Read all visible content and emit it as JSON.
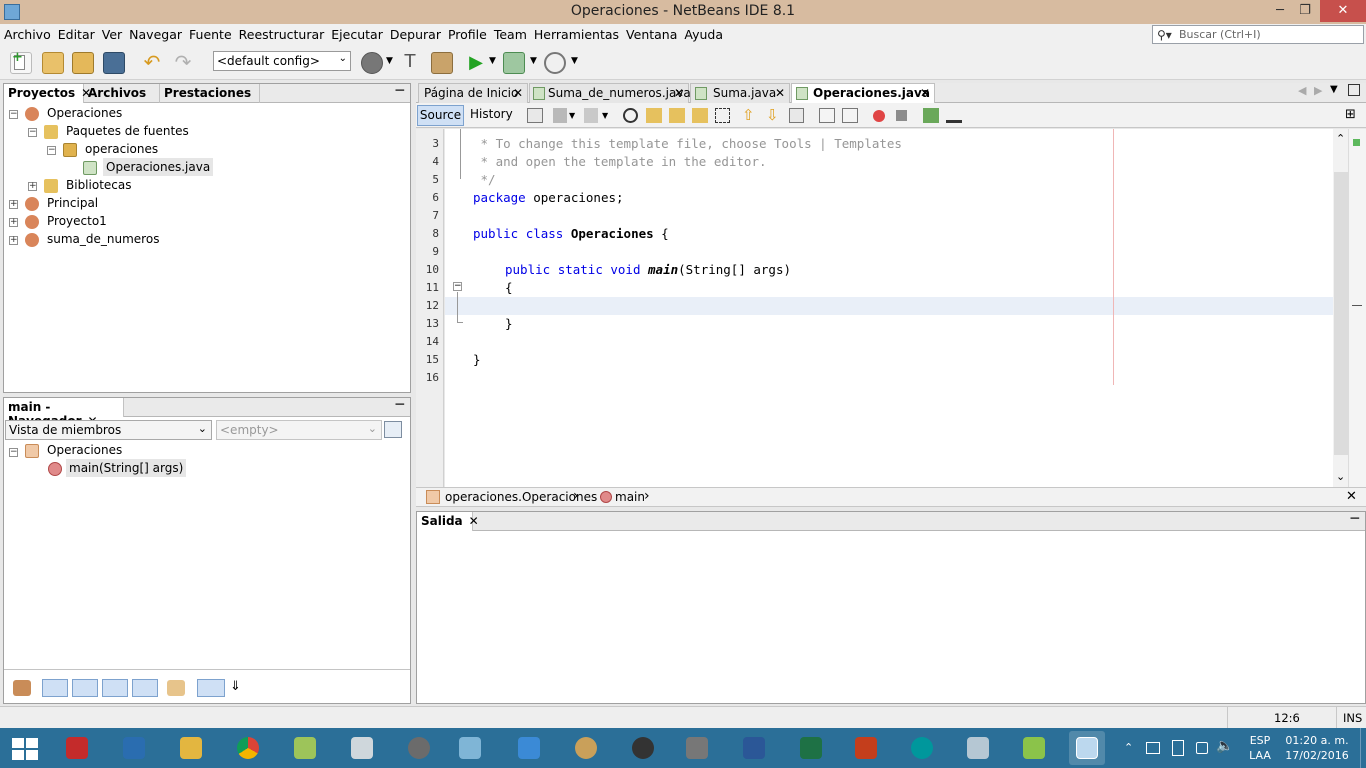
{
  "window": {
    "title": "Operaciones - NetBeans IDE 8.1",
    "controls": {
      "minimize": "─",
      "maximize": "❐",
      "close": "✕"
    }
  },
  "menu": [
    "Archivo",
    "Editar",
    "Ver",
    "Navegar",
    "Fuente",
    "Reestructurar",
    "Ejecutar",
    "Depurar",
    "Profile",
    "Team",
    "Herramientas",
    "Ventana",
    "Ayuda"
  ],
  "search": {
    "placeholder": "Buscar (Ctrl+I)"
  },
  "toolbar": {
    "config": "<default config>"
  },
  "projects_panel": {
    "tabs": [
      "Proyectos",
      "Archivos",
      "Prestaciones"
    ],
    "tree": [
      {
        "label": "Operaciones",
        "expanded": true
      },
      {
        "label": "Paquetes de fuentes",
        "expanded": true
      },
      {
        "label": "operaciones",
        "expanded": true
      },
      {
        "label": "Operaciones.java",
        "selected": true
      },
      {
        "label": "Bibliotecas",
        "expanded": false
      },
      {
        "label": "Principal",
        "expanded": false
      },
      {
        "label": "Proyecto1",
        "expanded": false
      },
      {
        "label": "suma_de_numeros",
        "expanded": false
      }
    ]
  },
  "navigator_panel": {
    "title": "main - Navegador",
    "view_select": "Vista de miembros",
    "filter_select": "<empty>",
    "tree": [
      {
        "label": "Operaciones"
      },
      {
        "label": "main(String[] args)"
      }
    ]
  },
  "editor": {
    "tabs": [
      {
        "label": "Página de Inicio",
        "active": false
      },
      {
        "label": "Suma_de_numeros.java",
        "active": false
      },
      {
        "label": "Suma.java",
        "active": false
      },
      {
        "label": "Operaciones.java",
        "active": true
      }
    ],
    "view_buttons": {
      "source": "Source",
      "history": "History"
    },
    "line_numbers": [
      "3",
      "4",
      "5",
      "6",
      "7",
      "8",
      "9",
      "10",
      "11",
      "12",
      "13",
      "14",
      "15",
      "16"
    ],
    "lines": {
      "l3": " * To change this template file, choose Tools | Templates",
      "l4": " * and open the template in the editor.",
      "l5": " */",
      "l6_kw": "package",
      "l6_rest": " operaciones;",
      "l8_kw1": "public",
      "l8_kw2": "class",
      "l8_name": "Operaciones",
      "l8_rest": " {",
      "l10_kw1": "public",
      "l10_kw2": "static",
      "l10_kw3": "void",
      "l10_name": "main",
      "l10_rest": "(String[] args)",
      "l11": "{",
      "l13": "}",
      "l15": "}"
    },
    "breadcrumb": [
      "operaciones.Operaciones",
      "main"
    ]
  },
  "output_panel": {
    "title": "Salida"
  },
  "statusbar": {
    "position": "12:6",
    "mode": "INS"
  },
  "taskbar": {
    "tray": {
      "lang": "ESP",
      "layout": "LAA",
      "time": "01:20 a. m.",
      "date": "17/02/2016"
    },
    "app_colors": [
      "#c42b2b",
      "#2a6db0",
      "#e3b640",
      "#ffffff",
      "#9dc45a",
      "#cfd7dc",
      "#7fb5d6",
      "#3b8ad6",
      "#c9a05a",
      "#333333",
      "#6b6b6b",
      "#2b5797",
      "#1e7145",
      "#c43e1c",
      "#00979c",
      "#b5c7d3",
      "#8bc34a",
      "#1f5d8c"
    ]
  }
}
